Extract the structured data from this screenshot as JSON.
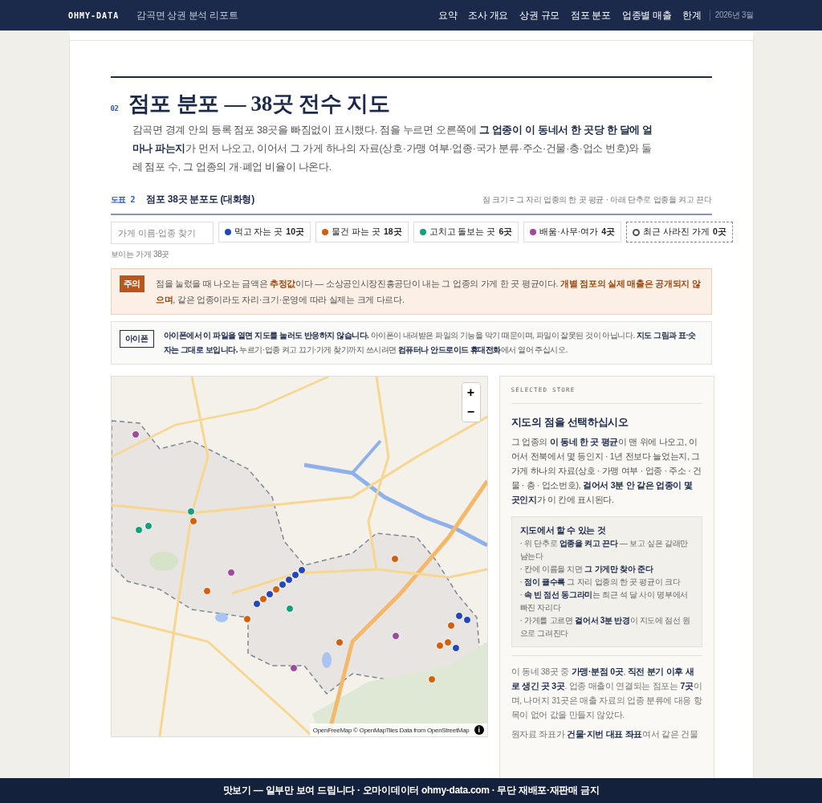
{
  "header": {
    "brand": "OHMY-DATA",
    "report_title": "감곡면 상권 분석 리포트",
    "nav": [
      {
        "label": "요약"
      },
      {
        "label": "조사 개요"
      },
      {
        "label": "상권 규모"
      },
      {
        "label": "점포 분포"
      },
      {
        "label": "업종별 매출"
      },
      {
        "label": "한계"
      }
    ],
    "date": "2026년 3월"
  },
  "section": {
    "number": "02",
    "title": "점포 분포 — 38곳 전수 지도",
    "intro": "감곡면 경계 안의 등록 점포 38곳을 빠짐없이 표시했다. 점을 누르면 오른쪽에 **그 업종이 이 동네서 한 곳당 한 달에 얼마나 파는지**가 먼저 나오고, 이어서 그 가게 하나의 자료(상호·가맹 여부·업종·국가 분류·주소·건물·층·업소 번호)와 둘레 점포 수, 그 업종의 개·폐업 비율이 나온다."
  },
  "figure": {
    "label": "도표 2",
    "title": "점포 38곳 분포도 (대화형)",
    "note": "점 크기 = 그 자리 업종의 한 곳 평균 · 아래 단추로 업종을 켜고 끈다"
  },
  "search": {
    "placeholder": "가게 이름·업종 찾기"
  },
  "legend": [
    {
      "kind": "dot",
      "color": "#2548b8",
      "label": "먹고 자는 곳",
      "count": "10곳",
      "on": true
    },
    {
      "kind": "dot",
      "color": "#d2600f",
      "label": "물건 파는 곳",
      "count": "18곳",
      "on": true
    },
    {
      "kind": "dot",
      "color": "#14a07a",
      "label": "고치고 돌보는 곳",
      "count": "6곳",
      "on": true
    },
    {
      "kind": "dot",
      "color": "#a04a98",
      "label": "배움·사무·여가",
      "count": "4곳",
      "on": true
    },
    {
      "kind": "ring",
      "color": "#555555",
      "label": "최근 사라진 가게",
      "count": "0곳",
      "on": true
    }
  ],
  "visible_count": "보이는 가게 38곳",
  "caution": {
    "badge": "주의",
    "text": "점을 눌렀을 때 나오는 금액은 **추정값**이다 — 소상공인시장진흥공단이 내는 그 업종의 가게 한 곳 평균이다. **개별 점포의 실제 매출은 공개되지 않으며**, 같은 업종이라도 자리·크기·운영에 따라 실제는 크게 다르다."
  },
  "iphone_note": {
    "badge": "아이폰",
    "text": "**아이폰에서 이 파일을 열면 지도를 눌러도 반응하지 않습니다.** 아이폰이 내려받은 파일의 기능을 막기 때문이며, 파일이 잘못된 것이 아닙니다. **지도 그림과 표·숫자는 그대로 보입니다.** 누르기·업종 켜고 끄기·가게 찾기까지 쓰시려면 **컴퓨터나 안드로이드 휴대전화**에서 열어 주십시오."
  },
  "map": {
    "zoom_in": "+",
    "zoom_out": "−",
    "attribution": "OpenFreeMap © OpenMapTiles Data from OpenStreetMap",
    "info": "i",
    "markers": [
      {
        "color": "#a04a98"
      },
      {
        "color": "#14a07a"
      },
      {
        "color": "#14a07a"
      },
      {
        "color": "#14a07a"
      },
      {
        "color": "#d2600f"
      },
      {
        "color": "#a04a98"
      },
      {
        "color": "#d2600f"
      },
      {
        "color": "#2548b8"
      },
      {
        "color": "#2548b8"
      },
      {
        "color": "#2548b8"
      },
      {
        "color": "#2548b8"
      },
      {
        "color": "#2548b8"
      },
      {
        "color": "#2548b8"
      },
      {
        "color": "#d2600f"
      },
      {
        "color": "#d2600f"
      },
      {
        "color": "#14a07a"
      },
      {
        "color": "#d2600f"
      },
      {
        "color": "#d2600f"
      },
      {
        "color": "#a04a98"
      },
      {
        "color": "#d2600f"
      },
      {
        "color": "#a04a98"
      },
      {
        "color": "#d2600f"
      },
      {
        "color": "#d2600f"
      },
      {
        "color": "#d2600f"
      },
      {
        "color": "#2548b8"
      },
      {
        "color": "#2548b8"
      },
      {
        "color": "#2548b8"
      },
      {
        "color": "#d2600f"
      }
    ]
  },
  "panel": {
    "eyebrow": "SELECTED STORE",
    "heading": "지도의 점을 선택하십시오",
    "text": "그 업종의 **이 동네 한 곳 평균**이 맨 위에 나오고, 이어서 전북에서 몇 등인지 · 1년 전보다 늘었는지, 그 가게 하나의 자료(상호 · 가맹 여부 · 업종 · 주소 · 건물 · 층 · 업소번호), **걸어서 3분 안 같은 업종이 몇 곳인지**가 이 칸에 표시된다.",
    "tips_title": "지도에서 할 수 있는 것",
    "tips": [
      "· 위 단추로 **업종을 켜고 끈다** — 보고 싶은 갈래만 남는다",
      "· 칸에 이름을 치면 **그 가게만 찾아 준다**",
      "· **점이 클수록** 그 자리 업종의 한 곳 평균이 크다",
      "· **속 빈 점선 동그라미**는 최근 석 달 사이 명부에서 빠진 자리다",
      "· 가게를 고르면 **걸어서 3분 반경**이 지도에 점선 원으로 그려진다"
    ],
    "summary": "이 동네 38곳 중 **가맹·분점 0곳**, **직전 분기 이후 새로 생긴 곳 3곳**. 업종 매출이 연결되는 점포는 **7곳**이며, 나머지 31곳은 매출 자료의 업종 분류에 대응 항목이 없어 값을 만들지 않았다.",
    "footnote": "원자료 좌표가 **건물·지번 대표 좌표**여서 같은 건물"
  },
  "footer": "맛보기 — 일부만 보여 드립니다 · 오마이데이터 ohmy-data.com · 무단 재배포·재판매 금지"
}
